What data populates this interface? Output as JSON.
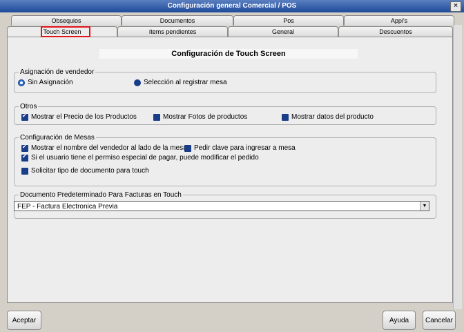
{
  "window": {
    "title": "Configuración general Comercial / POS",
    "close_label": "×"
  },
  "tabs_back": [
    "Obsequios",
    "Documentos",
    "Pos",
    "Appi's"
  ],
  "tabs_front": [
    "Touch Screen",
    "ítems pendientes",
    "General",
    "Descuentos"
  ],
  "active_tab": "Touch Screen",
  "page": {
    "title": "Configuración de Touch Screen"
  },
  "vendedor": {
    "legend": "Asignación de vendedor",
    "options": [
      {
        "label": "Sin Asignación",
        "selected": true
      },
      {
        "label": "Selección al registrar mesa",
        "selected": false
      }
    ]
  },
  "otros": {
    "legend": "Otros",
    "items": [
      {
        "label": "Mostrar el Precio de los Productos",
        "checked": true
      },
      {
        "label": "Mostrar Fotos de productos",
        "checked": false
      },
      {
        "label": "Mostrar datos del producto",
        "checked": false
      }
    ]
  },
  "mesas": {
    "legend": "Configuración de Mesas",
    "items": [
      {
        "label": "Mostrar el nombre del vendedor al lado de la mesa.",
        "checked": true
      },
      {
        "label": "Pedir clave para ingresar a mesa",
        "checked": false
      },
      {
        "label": "Si el usuario tiene el permiso especial de pagar, puede modificar el pedido",
        "checked": true
      },
      {
        "label": "Solicitar tipo de documento para touch",
        "checked": false
      }
    ]
  },
  "documento": {
    "legend": "Documento Predeterminado Para Facturas en Touch",
    "value": "FEP - Factura Electronica Previa",
    "arrow": "▼"
  },
  "buttons": {
    "accept": "Aceptar",
    "help": "Ayuda",
    "cancel": "Cancelar"
  }
}
